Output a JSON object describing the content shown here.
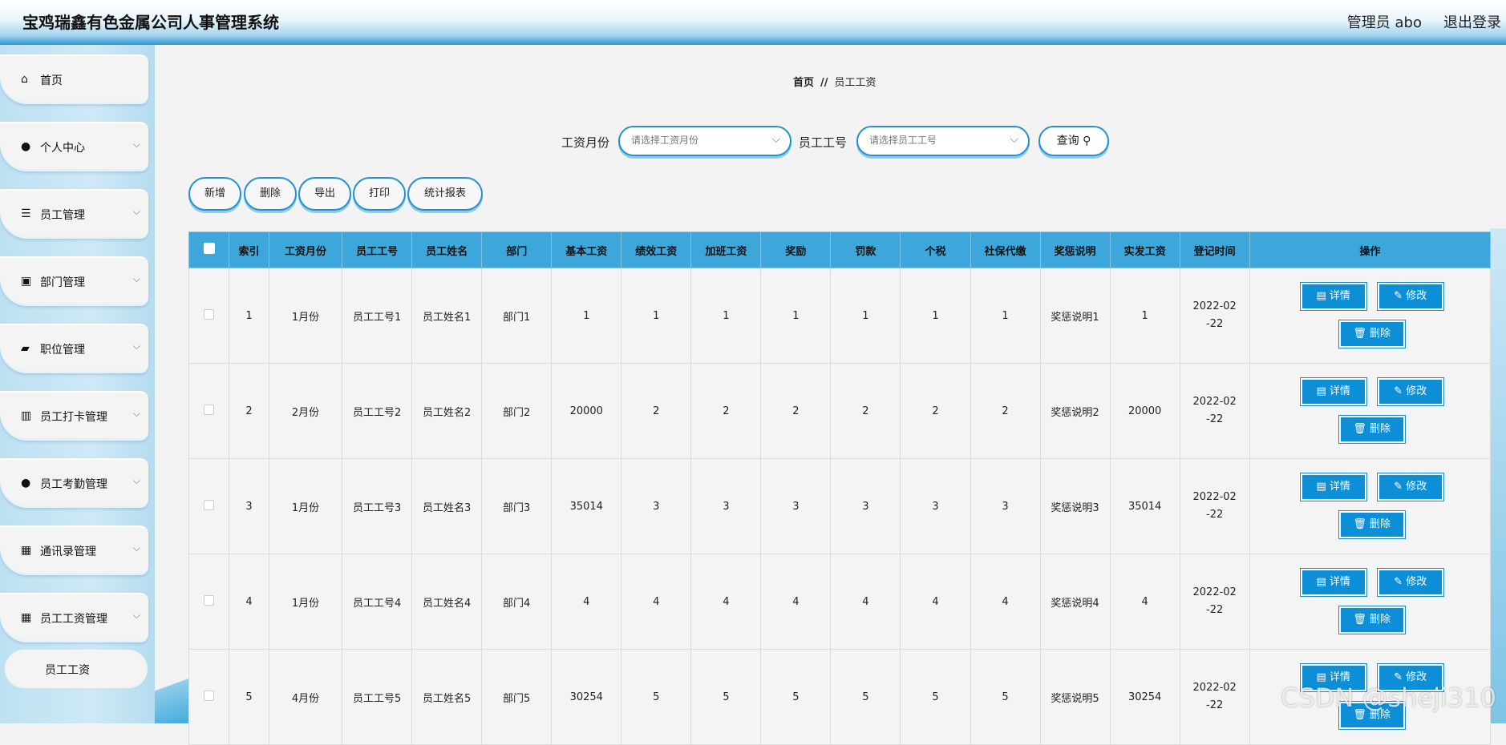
{
  "header": {
    "title": "宝鸡瑞鑫有色金属公司人事管理系统",
    "admin": "管理员 abo",
    "logout": "退出登录"
  },
  "sidebar": {
    "items": [
      {
        "label": "首页",
        "icon": "home-icon",
        "glyph": "⌂",
        "expandable": false
      },
      {
        "label": "个人中心",
        "icon": "user-icon",
        "glyph": "●",
        "expandable": true
      },
      {
        "label": "员工管理",
        "icon": "list-icon",
        "glyph": "☰",
        "expandable": true
      },
      {
        "label": "部门管理",
        "icon": "clipboard-icon",
        "glyph": "▣",
        "expandable": true
      },
      {
        "label": "职位管理",
        "icon": "ticket-icon",
        "glyph": "▰",
        "expandable": true
      },
      {
        "label": "员工打卡管理",
        "icon": "bar-chart-icon",
        "glyph": "▥",
        "expandable": true
      },
      {
        "label": "员工考勤管理",
        "icon": "user-icon",
        "glyph": "●",
        "expandable": true
      },
      {
        "label": "通讯录管理",
        "icon": "grid-icon",
        "glyph": "▦",
        "expandable": true
      },
      {
        "label": "员工工资管理",
        "icon": "grid-icon",
        "glyph": "▦",
        "expandable": true
      }
    ],
    "sub_item": "员工工资",
    "chevron": "⌵"
  },
  "breadcrumb": {
    "home": "首页",
    "sep": "//",
    "current": "员工工资"
  },
  "search": {
    "month_label": "工资月份",
    "month_placeholder": "请选择工资月份",
    "empno_label": "员工工号",
    "empno_placeholder": "请选择员工工号",
    "query_button": "查询 ⚲"
  },
  "toolbar": {
    "add": "新增",
    "delete": "删除",
    "export": "导出",
    "print": "打印",
    "report": "统计报表"
  },
  "table": {
    "headers": [
      "索引",
      "工资月份",
      "员工工号",
      "员工姓名",
      "部门",
      "基本工资",
      "绩效工资",
      "加班工资",
      "奖励",
      "罚款",
      "个税",
      "社保代缴",
      "奖惩说明",
      "实发工资",
      "登记时间",
      "操作"
    ],
    "rows": [
      [
        "1",
        "1月份",
        "员工工号1",
        "员工姓名1",
        "部门1",
        "1",
        "1",
        "1",
        "1",
        "1",
        "1",
        "1",
        "奖惩说明1",
        "1",
        "2022-02-22"
      ],
      [
        "2",
        "2月份",
        "员工工号2",
        "员工姓名2",
        "部门2",
        "20000",
        "2",
        "2",
        "2",
        "2",
        "2",
        "2",
        "奖惩说明2",
        "20000",
        "2022-02-22"
      ],
      [
        "3",
        "1月份",
        "员工工号3",
        "员工姓名3",
        "部门3",
        "35014",
        "3",
        "3",
        "3",
        "3",
        "3",
        "3",
        "奖惩说明3",
        "35014",
        "2022-02-22"
      ],
      [
        "4",
        "1月份",
        "员工工号4",
        "员工姓名4",
        "部门4",
        "4",
        "4",
        "4",
        "4",
        "4",
        "4",
        "4",
        "奖惩说明4",
        "4",
        "2022-02-22"
      ],
      [
        "5",
        "4月份",
        "员工工号5",
        "员工姓名5",
        "部门5",
        "30254",
        "5",
        "5",
        "5",
        "5",
        "5",
        "5",
        "奖惩说明5",
        "30254",
        "2022-02-22"
      ]
    ],
    "ops": {
      "detail": "▤ 详情",
      "edit": "✎ 修改",
      "delete": "🗑 删除"
    }
  },
  "watermark": "CSDN @sheji310"
}
